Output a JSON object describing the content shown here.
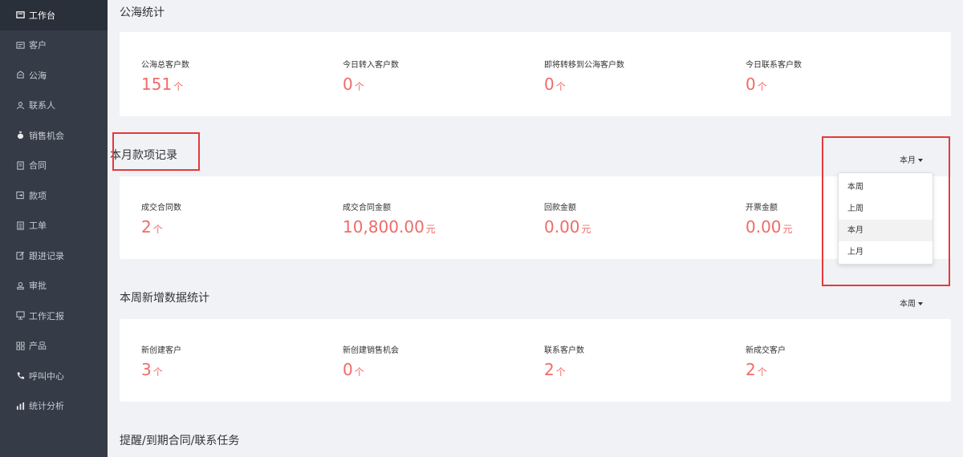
{
  "colors": {
    "sidebar_bg": "#353c47",
    "sidebar_active": "#2a3039",
    "accent_red": "#f06b68",
    "highlight_box": "#e4393c"
  },
  "sidebar": {
    "items": [
      {
        "label": "工作台",
        "icon": "dashboard-icon",
        "active": true
      },
      {
        "label": "客户",
        "icon": "customer-icon"
      },
      {
        "label": "公海",
        "icon": "pool-icon"
      },
      {
        "label": "联系人",
        "icon": "contact-icon"
      },
      {
        "label": "销售机会",
        "icon": "moneybag-icon"
      },
      {
        "label": "合同",
        "icon": "contract-icon"
      },
      {
        "label": "款项",
        "icon": "payment-icon"
      },
      {
        "label": "工单",
        "icon": "ticket-icon"
      },
      {
        "label": "跟进记录",
        "icon": "edit-icon"
      },
      {
        "label": "审批",
        "icon": "approval-icon"
      },
      {
        "label": "工作汇报",
        "icon": "report-icon"
      },
      {
        "label": "产品",
        "icon": "product-icon"
      },
      {
        "label": "呼叫中心",
        "icon": "phone-icon"
      },
      {
        "label": "统计分析",
        "icon": "chart-icon"
      }
    ]
  },
  "pool_stats": {
    "title": "公海统计",
    "items": [
      {
        "label": "公海总客户数",
        "value": "151",
        "unit": "个"
      },
      {
        "label": "今日转入客户数",
        "value": "0",
        "unit": "个"
      },
      {
        "label": "即将转移到公海客户数",
        "value": "0",
        "unit": "个"
      },
      {
        "label": "今日联系客户数",
        "value": "0",
        "unit": "个"
      }
    ]
  },
  "payment_records": {
    "title": "本月款项记录",
    "period": "本月",
    "items": [
      {
        "label": "成交合同数",
        "value": "2",
        "unit": "个"
      },
      {
        "label": "成交合同金额",
        "value": "10,800.00",
        "unit": "元"
      },
      {
        "label": "回款金额",
        "value": "0.00",
        "unit": "元"
      },
      {
        "label": "开票金额",
        "value": "0.00",
        "unit": "元"
      }
    ],
    "dropdown_options": [
      "本周",
      "上周",
      "本月",
      "上月"
    ],
    "selected_option": "本月"
  },
  "weekly_new": {
    "title": "本周新增数据统计",
    "period": "本周",
    "items": [
      {
        "label": "新创建客户",
        "value": "3",
        "unit": "个"
      },
      {
        "label": "新创建销售机会",
        "value": "0",
        "unit": "个"
      },
      {
        "label": "联系客户数",
        "value": "2",
        "unit": "个"
      },
      {
        "label": "新成交客户",
        "value": "2",
        "unit": "个"
      }
    ]
  },
  "reminders": {
    "title": "提醒/到期合同/联系任务"
  }
}
